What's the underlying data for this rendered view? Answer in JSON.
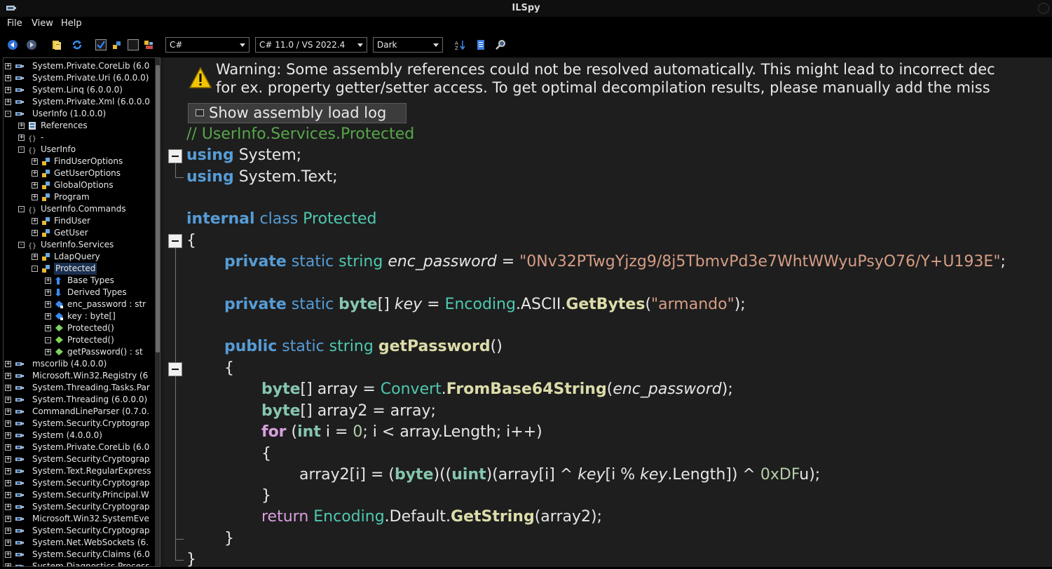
{
  "window": {
    "title": "ILSpy"
  },
  "menu": [
    "File",
    "View",
    "Help"
  ],
  "toolbar": {
    "language": "C#",
    "version": "C# 11.0 / VS 2022.4",
    "theme": "Dark"
  },
  "tree": [
    {
      "label": "System.Private.CoreLib (6.0",
      "icon": "assembly-icon",
      "level": 0,
      "exp": "+"
    },
    {
      "label": "System.Private.Uri (6.0.0.0)",
      "icon": "assembly-icon",
      "level": 0,
      "exp": "+"
    },
    {
      "label": "System.Linq (6.0.0.0)",
      "icon": "assembly-icon",
      "level": 0,
      "exp": "+"
    },
    {
      "label": "System.Private.Xml (6.0.0.0",
      "icon": "assembly-icon",
      "level": 0,
      "exp": "+"
    },
    {
      "label": "UserInfo (1.0.0.0)",
      "icon": "assembly-icon",
      "level": 0,
      "exp": "-"
    },
    {
      "label": "References",
      "icon": "references-icon",
      "level": 1,
      "exp": "+"
    },
    {
      "label": "-",
      "icon": "namespace-icon",
      "level": 1,
      "exp": "+"
    },
    {
      "label": "UserInfo",
      "icon": "namespace-icon",
      "level": 1,
      "exp": "-"
    },
    {
      "label": "FindUserOptions",
      "icon": "class-icon",
      "level": 2,
      "exp": "+"
    },
    {
      "label": "GetUserOptions",
      "icon": "class-icon",
      "level": 2,
      "exp": "+"
    },
    {
      "label": "GlobalOptions",
      "icon": "class-icon",
      "level": 2,
      "exp": "+"
    },
    {
      "label": "Program",
      "icon": "class-icon",
      "level": 2,
      "exp": "+"
    },
    {
      "label": "UserInfo.Commands",
      "icon": "namespace-icon",
      "level": 1,
      "exp": "-"
    },
    {
      "label": "FindUser",
      "icon": "class-icon",
      "level": 2,
      "exp": "+"
    },
    {
      "label": "GetUser",
      "icon": "class-icon",
      "level": 2,
      "exp": "+"
    },
    {
      "label": "UserInfo.Services",
      "icon": "namespace-icon",
      "level": 1,
      "exp": "-"
    },
    {
      "label": "LdapQuery",
      "icon": "class-icon",
      "level": 2,
      "exp": "+"
    },
    {
      "label": "Protected",
      "icon": "class-icon",
      "level": 2,
      "exp": "-",
      "selected": true
    },
    {
      "label": "Base Types",
      "icon": "base-types-icon",
      "level": 3,
      "exp": "+"
    },
    {
      "label": "Derived Types",
      "icon": "derived-types-icon",
      "level": 3,
      "exp": "+"
    },
    {
      "label": "enc_password : str",
      "icon": "field-icon",
      "level": 3,
      "exp": "+"
    },
    {
      "label": "key : byte[]",
      "icon": "field-icon",
      "level": 3,
      "exp": "+"
    },
    {
      "label": "Protected()",
      "icon": "method-icon",
      "level": 3,
      "exp": "+"
    },
    {
      "label": "Protected()",
      "icon": "method-icon",
      "level": 3,
      "exp": "-"
    },
    {
      "label": "getPassword() : st",
      "icon": "method-icon",
      "level": 3,
      "exp": "+"
    },
    {
      "label": "mscorlib (4.0.0.0)",
      "icon": "assembly-icon",
      "level": 0,
      "exp": "+"
    },
    {
      "label": "Microsoft.Win32.Registry (6",
      "icon": "assembly-icon",
      "level": 0,
      "exp": "+"
    },
    {
      "label": "System.Threading.Tasks.Par",
      "icon": "assembly-icon",
      "level": 0,
      "exp": "+"
    },
    {
      "label": "System.Threading (6.0.0.0)",
      "icon": "assembly-icon",
      "level": 0,
      "exp": "+"
    },
    {
      "label": "CommandLineParser (0.7.0.",
      "icon": "assembly-icon",
      "level": 0,
      "exp": "+"
    },
    {
      "label": "System.Security.Cryptograp",
      "icon": "assembly-icon",
      "level": 0,
      "exp": "+"
    },
    {
      "label": "System (4.0.0.0)",
      "icon": "assembly-icon",
      "level": 0,
      "exp": "+"
    },
    {
      "label": "System.Private.CoreLib (6.0",
      "icon": "assembly-icon",
      "level": 0,
      "exp": "+"
    },
    {
      "label": "System.Security.Cryptograp",
      "icon": "assembly-icon",
      "level": 0,
      "exp": "+"
    },
    {
      "label": "System.Text.RegularExpress",
      "icon": "assembly-icon",
      "level": 0,
      "exp": "+"
    },
    {
      "label": "System.Security.Cryptograp",
      "icon": "assembly-icon",
      "level": 0,
      "exp": "+"
    },
    {
      "label": "System.Security.Principal.W",
      "icon": "assembly-icon",
      "level": 0,
      "exp": "+"
    },
    {
      "label": "System.Security.Cryptograp",
      "icon": "assembly-icon",
      "level": 0,
      "exp": "+"
    },
    {
      "label": "Microsoft.Win32.SystemEve",
      "icon": "assembly-icon",
      "level": 0,
      "exp": "+"
    },
    {
      "label": "System.Security.Cryptograp",
      "icon": "assembly-icon",
      "level": 0,
      "exp": "+"
    },
    {
      "label": "System.Net.WebSockets (6.",
      "icon": "assembly-icon",
      "level": 0,
      "exp": "+"
    },
    {
      "label": "System.Security.Claims (6.0",
      "icon": "assembly-icon",
      "level": 0,
      "exp": "+"
    },
    {
      "label": "System.Diagnostics.Process",
      "icon": "assembly-icon",
      "level": 0,
      "exp": "+"
    }
  ],
  "editor": {
    "warning_line1": "Warning: Some assembly references could not be resolved automatically. This might lead to incorrect dec",
    "warning_line2": "for ex. property getter/setter access. To get optimal decompilation results, please manually add the miss",
    "load_log_button": "Show assembly load log",
    "code": {
      "comment": "// UserInfo.Services.Protected",
      "using1_kw": "using",
      "using1_ns": " System;",
      "using2_kw": "using",
      "using2_ns": " System.Text;",
      "class_mod": "internal",
      "class_kw": " class ",
      "class_name": "Protected",
      "brace_open": "{",
      "f1_mod": "private",
      "f1_static": " static ",
      "f1_type": "string",
      "f1_name": "enc_password",
      "f1_eq": " = ",
      "f1_val": "\"0Nv32PTwgYjzg9/8j5TbmvPd3e7WhtWWyuPsyO76/Y+U193E\"",
      "f1_end": ";",
      "f2_mod": "private",
      "f2_static": " static ",
      "f2_type": "byte",
      "f2_arr": "[] ",
      "f2_name": "key",
      "f2_eq": " = ",
      "f2_cls": "Encoding",
      "f2_mid": ".ASCII.",
      "f2_m": "GetBytes",
      "f2_p1": "(",
      "f2_val": "\"armando\"",
      "f2_end": ");",
      "m_mod": "public",
      "m_static": " static ",
      "m_type": "string",
      "m_sp": " ",
      "m_name": "getPassword",
      "m_par": "()",
      "m_open": "{",
      "l1_type": "byte",
      "l1_a": "[] array = ",
      "l1_cls": "Convert",
      "l1_dot": ".",
      "l1_m": "FromBase64String",
      "l1_p": "(",
      "l1_arg": "enc_password",
      "l1_end": ");",
      "l2_type": "byte",
      "l2_a": "[] array2 = array;",
      "l3_for": "for",
      "l3_p": " (",
      "l3_int": "int",
      "l3_a": " i = ",
      "l3_zero": "0",
      "l3_b": "; i < array.Length; i++)",
      "l4_open": "{",
      "l5_a": "array2[i] = (",
      "l5_byte": "byte",
      "l5_b": ")((",
      "l5_uint": "uint",
      "l5_c": ")(array[i] ^ ",
      "l5_key": "key",
      "l5_d": "[i % ",
      "l5_key2": "key",
      "l5_e": ".Length]) ^ ",
      "l5_hex": "0xDF",
      "l5_f": "u);",
      "l6_close": "}",
      "l7_ret": "return",
      "l7_sp": " ",
      "l7_cls": "Encoding",
      "l7_a": ".Default.",
      "l7_m": "GetString",
      "l7_b": "(array2);",
      "m_close": "}",
      "brace_close": "}"
    }
  }
}
